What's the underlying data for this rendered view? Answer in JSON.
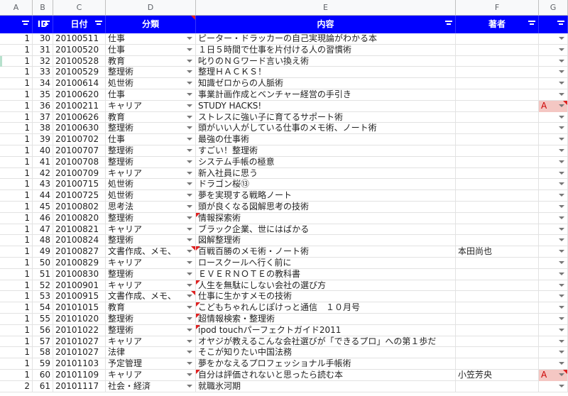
{
  "columns": [
    "A",
    "B",
    "C",
    "D",
    "E",
    "F",
    "G"
  ],
  "header": {
    "a": "",
    "b": "ID",
    "c": "日付",
    "d": "分類",
    "e": "内容",
    "f": "著者",
    "g": ""
  },
  "rows": [
    {
      "a": "1",
      "id": "30",
      "date": "20100511",
      "cat": "仕事",
      "title": "ピーター・ドラッカーの自己実現論がわかる本",
      "author": "",
      "g": ""
    },
    {
      "a": "1",
      "id": "31",
      "date": "20100520",
      "cat": "仕事",
      "title": "１日５時間で仕事を片付ける人の習慣術",
      "author": "",
      "g": ""
    },
    {
      "a": "1",
      "id": "32",
      "date": "20100528",
      "cat": "教育",
      "title": "叱りのＮＧワード言い換え術",
      "author": "",
      "g": ""
    },
    {
      "a": "1",
      "id": "33",
      "date": "20100529",
      "cat": "整理術",
      "title": "整理ＨＡＣＫＳ！",
      "author": "",
      "g": ""
    },
    {
      "a": "1",
      "id": "34",
      "date": "20100614",
      "cat": "処世術",
      "title": "知識ゼロからの人脈術",
      "author": "",
      "g": ""
    },
    {
      "a": "1",
      "id": "35",
      "date": "20100620",
      "cat": "仕事",
      "title": "事業計画作成とベンチャー経営の手引き",
      "author": "",
      "g": ""
    },
    {
      "a": "1",
      "id": "36",
      "date": "20100211",
      "cat": "キャリア",
      "title": "STUDY HACKS!",
      "author": "",
      "g": "A"
    },
    {
      "a": "1",
      "id": "37",
      "date": "20100626",
      "cat": "教育",
      "title": "ストレスに強い子に育てるサポート術",
      "author": "",
      "g": ""
    },
    {
      "a": "1",
      "id": "38",
      "date": "20100630",
      "cat": "整理術",
      "title": "頭がいい人がしている仕事のメモ術、ノート術",
      "author": "",
      "g": ""
    },
    {
      "a": "1",
      "id": "39",
      "date": "20100702",
      "cat": "仕事",
      "title": "最強の仕事術",
      "author": "",
      "g": ""
    },
    {
      "a": "1",
      "id": "40",
      "date": "20100707",
      "cat": "整理術",
      "title": "すごい！整理術",
      "author": "",
      "g": ""
    },
    {
      "a": "1",
      "id": "41",
      "date": "20100708",
      "cat": "整理術",
      "title": "システム手帳の極意",
      "author": "",
      "g": ""
    },
    {
      "a": "1",
      "id": "42",
      "date": "20100709",
      "cat": "キャリア",
      "title": "新入社員に思う",
      "author": "",
      "g": ""
    },
    {
      "a": "1",
      "id": "43",
      "date": "20100715",
      "cat": "処世術",
      "title": "ドラゴン桜⑬",
      "author": "",
      "g": ""
    },
    {
      "a": "1",
      "id": "44",
      "date": "20100725",
      "cat": "処世術",
      "title": "夢を実現する戦略ノート",
      "author": "",
      "g": ""
    },
    {
      "a": "1",
      "id": "45",
      "date": "20100802",
      "cat": "思考法",
      "title": "頭が良くなる図解思考の技術",
      "author": "",
      "g": ""
    },
    {
      "a": "1",
      "id": "46",
      "date": "20100820",
      "cat": "整理術",
      "title": "情報探索術",
      "author": "",
      "g": ""
    },
    {
      "a": "1",
      "id": "47",
      "date": "20100821",
      "cat": "キャリア",
      "title": "ブラック企業、世にはばかる",
      "author": "",
      "g": ""
    },
    {
      "a": "1",
      "id": "48",
      "date": "20100824",
      "cat": "整理術",
      "title": "図解整理術",
      "author": "",
      "g": ""
    },
    {
      "a": "1",
      "id": "49",
      "date": "20100827",
      "cat": "文書作成、メモ、",
      "title": "百戦百勝のメモ術・ノート術",
      "author": "本田尚也",
      "g": ""
    },
    {
      "a": "1",
      "id": "50",
      "date": "20100829",
      "cat": "キャリア",
      "title": "ロースクールへ行く前に",
      "author": "",
      "g": ""
    },
    {
      "a": "1",
      "id": "51",
      "date": "20100830",
      "cat": "整理術",
      "title": "ＥＶＥＲＮＯＴＥの教科書",
      "author": "",
      "g": ""
    },
    {
      "a": "1",
      "id": "52",
      "date": "20100901",
      "cat": "キャリア",
      "title": "人生を無駄にしない会社の選び方",
      "author": "",
      "g": ""
    },
    {
      "a": "1",
      "id": "53",
      "date": "20100915",
      "cat": "文書作成、メモ、",
      "title": "仕事に生かすメモの技術",
      "author": "",
      "g": ""
    },
    {
      "a": "1",
      "id": "54",
      "date": "20101015",
      "cat": "教育",
      "title": "こどもちゃれんじぽけっと通信　１０月号",
      "author": "",
      "g": ""
    },
    {
      "a": "1",
      "id": "55",
      "date": "20101020",
      "cat": "整理術",
      "title": "超情報検索・整理術",
      "author": "",
      "g": ""
    },
    {
      "a": "1",
      "id": "56",
      "date": "20101022",
      "cat": "整理術",
      "title": "ipod touchパーフェクトガイド2011",
      "author": "",
      "g": ""
    },
    {
      "a": "1",
      "id": "57",
      "date": "20101027",
      "cat": "キャリア",
      "title": "オヤジが教えるこんな会社選びが「できるプロ」への第１歩だ",
      "author": "",
      "g": ""
    },
    {
      "a": "1",
      "id": "58",
      "date": "20101027",
      "cat": "法律",
      "title": "そこが知りたい中国法務",
      "author": "",
      "g": ""
    },
    {
      "a": "1",
      "id": "59",
      "date": "20101103",
      "cat": "予定管理",
      "title": "夢をかなえるプロフェッショナル手帳術",
      "author": "",
      "g": ""
    },
    {
      "a": "1",
      "id": "60",
      "date": "20101109",
      "cat": "キャリア",
      "title": "自分は評価されないと思ったら読む本",
      "author": "小笠芳央",
      "g": "A"
    },
    {
      "a": "2",
      "id": "61",
      "date": "20101117",
      "cat": "社会・経済",
      "title": "就職氷河期",
      "author": "",
      "g": ""
    }
  ],
  "colors": {
    "header_bg": "#0000ff",
    "header_text": "#ffffff",
    "highlight": "#f4c7c3",
    "note_red": "#e02020"
  }
}
